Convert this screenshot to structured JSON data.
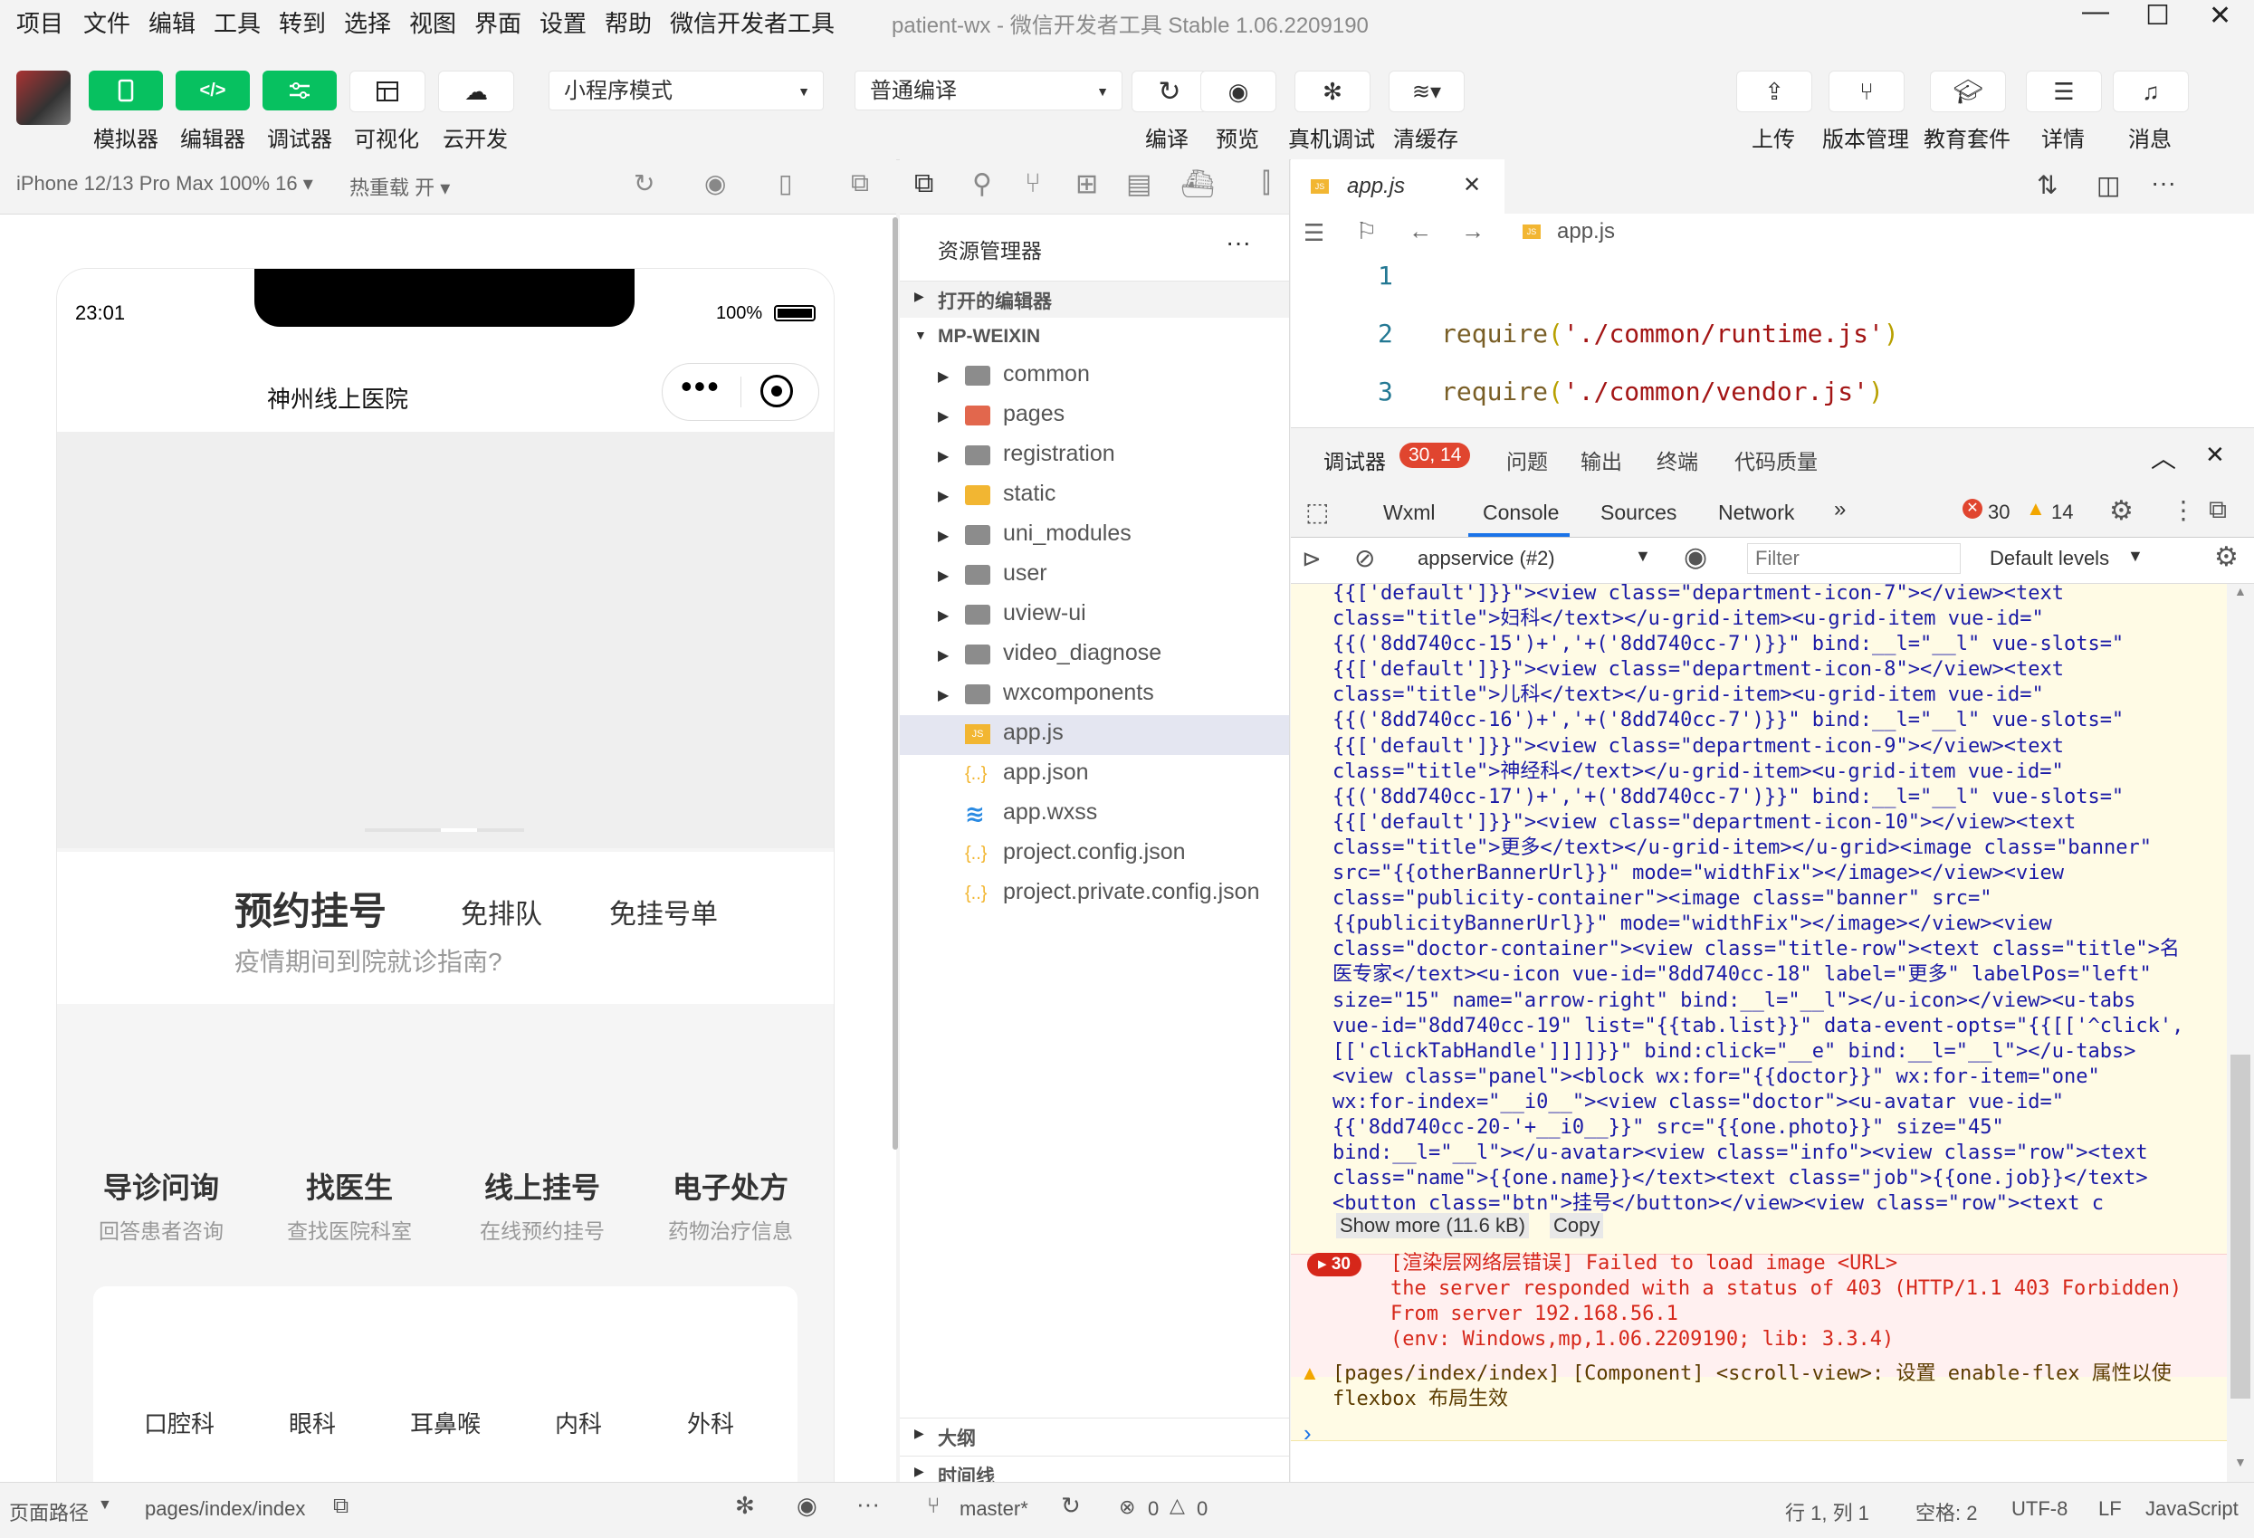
{
  "menu": [
    "项目",
    "文件",
    "编辑",
    "工具",
    "转到",
    "选择",
    "视图",
    "界面",
    "设置",
    "帮助",
    "微信开发者工具"
  ],
  "window": {
    "title": "patient-wx - 微信开发者工具 Stable 1.06.2209190"
  },
  "toolbar": {
    "left_buttons": [
      {
        "label": "模拟器",
        "icon": "phone-icon"
      },
      {
        "label": "编辑器",
        "icon": "code-icon"
      },
      {
        "label": "调试器",
        "icon": "debug-icon"
      },
      {
        "label": "可视化",
        "icon": "layout-icon"
      },
      {
        "label": "云开发",
        "icon": "cloud-icon"
      }
    ],
    "mode_select": "小程序模式",
    "compile_select": "普通编译",
    "center_buttons": [
      {
        "label": "编译",
        "icon": "refresh-icon"
      },
      {
        "label": "预览",
        "icon": "eye-icon"
      },
      {
        "label": "真机调试",
        "icon": "bug-icon"
      },
      {
        "label": "清缓存",
        "icon": "layers-icon"
      }
    ],
    "right_buttons": [
      {
        "label": "上传",
        "icon": "upload-icon"
      },
      {
        "label": "版本管理",
        "icon": "branch-icon"
      },
      {
        "label": "教育套件",
        "icon": "graduation-icon"
      },
      {
        "label": "详情",
        "icon": "menu-icon"
      },
      {
        "label": "消息",
        "icon": "bell-icon"
      }
    ]
  },
  "simulator": {
    "device": "iPhone 12/13 Pro Max 100% 16",
    "hotreload": "热重载 开",
    "time": "23:01",
    "battery": "100%",
    "page_title": "神州线上医院",
    "banner": {
      "main": "预约挂号",
      "tag1": "免排队",
      "tag2": "免挂号单",
      "sub": "疫情期间到院就诊指南?"
    },
    "services": [
      {
        "title": "导诊问询",
        "sub": "回答患者咨询"
      },
      {
        "title": "找医生",
        "sub": "查找医院科室"
      },
      {
        "title": "线上挂号",
        "sub": "在线预约挂号"
      },
      {
        "title": "电子处方",
        "sub": "药物治疗信息"
      }
    ],
    "departments": [
      "口腔科",
      "眼科",
      "耳鼻喉",
      "内科",
      "外科"
    ]
  },
  "explorer": {
    "title": "资源管理器",
    "open_editors": "打开的编辑器",
    "root": "MP-WEIXIN",
    "folders": [
      "common",
      "pages",
      "registration",
      "static",
      "uni_modules",
      "user",
      "uview-ui",
      "video_diagnose",
      "wxcomponents"
    ],
    "files": [
      {
        "name": "app.js",
        "type": "js"
      },
      {
        "name": "app.json",
        "type": "json"
      },
      {
        "name": "app.wxss",
        "type": "wxss"
      },
      {
        "name": "project.config.json",
        "type": "json"
      },
      {
        "name": "project.private.config.json",
        "type": "json"
      }
    ],
    "outline": "大纲",
    "timeline": "时间线"
  },
  "editor": {
    "tab": "app.js",
    "breadcrumb": "app.js",
    "lines": [
      {
        "num": "1",
        "fn": "",
        "str": ""
      },
      {
        "num": "2",
        "fn": "require",
        "str": "'./common/runtime.js'"
      },
      {
        "num": "3",
        "fn": "require",
        "str": "'./common/vendor.js'"
      }
    ]
  },
  "debugger": {
    "tab_main": "调试器",
    "badge": "30, 14",
    "tabs": [
      "问题",
      "输出",
      "终端",
      "代码质量"
    ],
    "devtabs": [
      "Wxml",
      "Console",
      "Sources",
      "Network"
    ],
    "errors": "30",
    "warnings": "14",
    "context": "appservice (#2)",
    "filter_placeholder": "Filter",
    "levels": "Default levels",
    "log_lines": [
      "{{['default']}}\"><view class=\"department-icon-7\"></view><text",
      "class=\"title\">妇科</text></u-grid-item><u-grid-item vue-id=\"",
      "{{('8dd740cc-15')+','+('8dd740cc-7')}}\" bind:__l=\"__l\" vue-slots=\"",
      "{{['default']}}\"><view class=\"department-icon-8\"></view><text",
      "class=\"title\">儿科</text></u-grid-item><u-grid-item vue-id=\"",
      "{{('8dd740cc-16')+','+('8dd740cc-7')}}\" bind:__l=\"__l\" vue-slots=\"",
      "{{['default']}}\"><view class=\"department-icon-9\"></view><text",
      "class=\"title\">神经科</text></u-grid-item><u-grid-item vue-id=\"",
      "{{('8dd740cc-17')+','+('8dd740cc-7')}}\" bind:__l=\"__l\" vue-slots=\"",
      "{{['default']}}\"><view class=\"department-icon-10\"></view><text",
      "class=\"title\">更多</text></u-grid-item></u-grid><image class=\"banner\"",
      "src=\"{{otherBannerUrl}}\" mode=\"widthFix\"></image></view><view",
      "class=\"publicity-container\"><image class=\"banner\" src=\"",
      "{{publicityBannerUrl}}\" mode=\"widthFix\"></image></view><view",
      "class=\"doctor-container\"><view class=\"title-row\"><text class=\"title\">名",
      "医专家</text><u-icon vue-id=\"8dd740cc-18\" label=\"更多\" labelPos=\"left\"",
      "size=\"15\" name=\"arrow-right\" bind:__l=\"__l\"></u-icon></view><u-tabs",
      "vue-id=\"8dd740cc-19\" list=\"{{tab.list}}\" data-event-opts=\"{{[['^click',",
      "[['clickTabHandle']]]]}}\" bind:click=\"__e\" bind:__l=\"__l\"></u-tabs>",
      "<view class=\"panel\"><block wx:for=\"{{doctor}}\" wx:for-item=\"one\"",
      "wx:for-index=\"__i0__\"><view class=\"doctor\"><u-avatar vue-id=\"",
      "{{'8dd740cc-20-'+__i0__}}\" src=\"{{one.photo}}\" size=\"45\"",
      "bind:__l=\"__l\"></u-avatar><view class=\"info\"><view class=\"row\"><text",
      "class=\"name\">{{one.name}}</text><text class=\"job\">{{one.job}}</text>",
      "<button class=\"btn\">挂号</button></view><view class=\"row\"><text c"
    ],
    "show_more": "Show more (11.6 kB)",
    "copy": "Copy",
    "error_count": "30",
    "error_lines": [
      "[渲染层网络层错误] Failed to load image <URL>",
      "the server responded with a status of 403 (HTTP/1.1 403 Forbidden)",
      "From server 192.168.56.1",
      "(env: Windows,mp,1.06.2209190; lib: 3.3.4)"
    ],
    "warn_lines": [
      "[pages/index/index] [Component] <scroll-view>: 设置 enable-flex 属性以使",
      "flexbox 布局生效"
    ],
    "prompt": "›"
  },
  "status": {
    "page_path_label": "页面路径",
    "page_path": "pages/index/index",
    "branch": "master*",
    "problems": "0",
    "warnings": "0",
    "cursor": "行 1, 列 1",
    "spaces": "空格: 2",
    "encoding": "UTF-8",
    "eol": "LF",
    "language": "JavaScript"
  }
}
